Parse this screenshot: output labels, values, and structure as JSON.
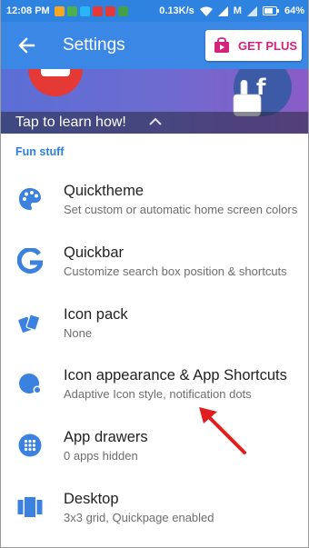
{
  "status_bar": {
    "time": "12:08 PM",
    "speed": "0.13K/s",
    "carrier": "M",
    "battery": "64%",
    "app_icon_colors": [
      "#f5a623",
      "#4caf50",
      "#29b6f6",
      "#e53935",
      "#e53935",
      "#43a047"
    ]
  },
  "app_bar": {
    "title": "Settings",
    "get_plus_label": "GET PLUS",
    "accent": "#3b87e6",
    "plus_color": "#d4237b"
  },
  "banner": {
    "tap_text": "Tap to learn how!"
  },
  "section_header": "Fun stuff",
  "items": [
    {
      "title": "Quicktheme",
      "subtitle": "Set custom or automatic home screen colors",
      "icon": "palette-icon"
    },
    {
      "title": "Quickbar",
      "subtitle": "Customize search box position & shortcuts",
      "icon": "google-g-icon"
    },
    {
      "title": "Icon pack",
      "subtitle": "None",
      "icon": "icon-pack-icon"
    },
    {
      "title": "Icon appearance & App Shortcuts",
      "subtitle": "Adaptive Icon style, notification dots",
      "icon": "icon-appearance-icon"
    },
    {
      "title": "App drawers",
      "subtitle": "0 apps hidden",
      "icon": "app-drawer-icon"
    },
    {
      "title": "Desktop",
      "subtitle": "3x3 grid, Quickpage enabled",
      "icon": "desktop-icon"
    }
  ]
}
